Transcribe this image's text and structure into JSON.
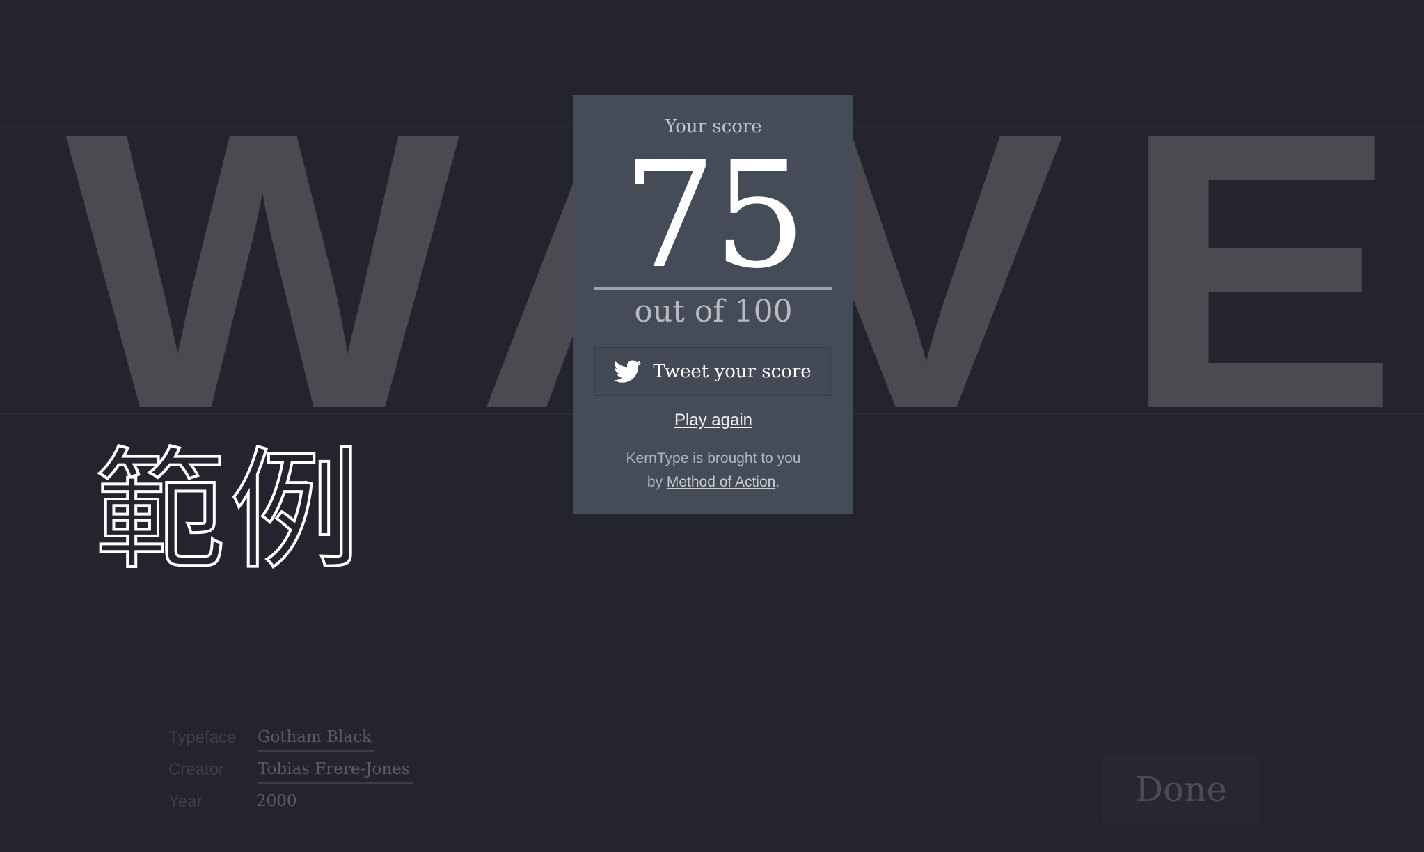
{
  "background_word": {
    "letters": [
      "W",
      "A",
      "V",
      "E"
    ]
  },
  "sample_glyphs": "範例",
  "typeface_info": {
    "typeface_label": "Typeface",
    "typeface_value": "Gotham Black",
    "creator_label": "Creator",
    "creator_value": "Tobias Frere-Jones",
    "year_label": "Year",
    "year_value": "2000"
  },
  "done_button": {
    "label": "Done"
  },
  "score_modal": {
    "label": "Your score",
    "score": "75",
    "out_of": "out of 100",
    "tweet_label": "Tweet your score",
    "play_again_label": "Play again",
    "credit_prefix_line1": "KernType is brought to you",
    "credit_prefix_line2": "by",
    "credit_link": "Method of Action",
    "credit_suffix": "."
  },
  "colors": {
    "background": "#23242e",
    "letters": "#4b4a51",
    "modal": "#454c58",
    "text_primary": "#ffffff"
  },
  "icons": {
    "tweet": "twitter-bird-icon"
  }
}
